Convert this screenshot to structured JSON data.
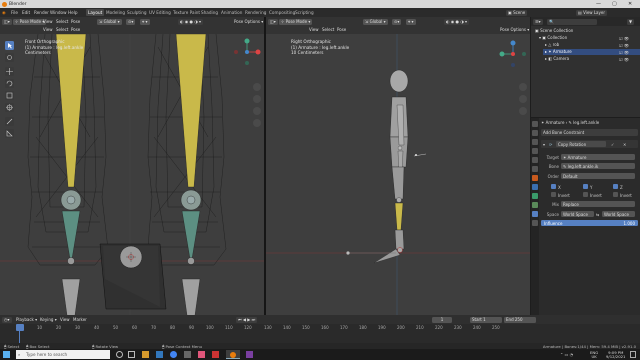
{
  "window": {
    "title": "Blender",
    "min": "—",
    "max": "▢",
    "close": "✕"
  },
  "menu": [
    "File",
    "Edit",
    "Render",
    "Window",
    "Help"
  ],
  "workspaces": [
    {
      "label": "Layout",
      "active": true
    },
    {
      "label": "Modeling"
    },
    {
      "label": "Sculpting"
    },
    {
      "label": "UV Editing"
    },
    {
      "label": "Texture Paint"
    },
    {
      "label": "Shading"
    },
    {
      "label": "Animation"
    },
    {
      "label": "Rendering"
    },
    {
      "label": "Compositing"
    },
    {
      "label": "Scripting"
    }
  ],
  "scene": {
    "label": "Scene",
    "view_layer": "View Layer"
  },
  "left_viewport": {
    "mode": "Pose Mode",
    "view": "View",
    "select": "Select",
    "pose": "Pose",
    "orientation": "Global",
    "options": "Pose Options ▾",
    "info_lines": [
      "Front Orthographic",
      "(1) Armature : leg.left.ankle",
      "Centimeters"
    ]
  },
  "right_viewport": {
    "mode": "Pose Mode",
    "view": "View",
    "select": "Select",
    "pose": "Pose",
    "orientation": "Global",
    "options": "Pose Options ▾",
    "info_lines": [
      "Right Orthographic",
      "(1) Armature : leg.left.ankle",
      "10 Centimeters"
    ]
  },
  "outliner": {
    "root": "Scene Collection",
    "items": [
      {
        "label": "Collection",
        "indent": 1
      },
      {
        "label": "rob",
        "indent": 2
      },
      {
        "label": "Armature",
        "indent": 2
      },
      {
        "label": "Camera",
        "indent": 2
      }
    ]
  },
  "properties": {
    "breadcrumb_obj": "Armature",
    "breadcrumb_bone": "leg.left.ankle",
    "add_button": "Add Bone Constraint",
    "constraint_name": "Copy Rotation",
    "target_label": "Target",
    "target_value": "Armature",
    "bone_label": "Bone",
    "bone_value": "leg.left.ankle.ik",
    "order_label": "Order",
    "order_value": "Default",
    "axis_label_x": "X",
    "axis_label_y": "Y",
    "axis_label_z": "Z",
    "invert_label": "Invert",
    "mix_label": "Mix",
    "mix_value": "Replace",
    "space_label": "Space",
    "space_owner": "World Space",
    "space_arrow": "⇆",
    "space_target": "World Space",
    "influence_label": "Influence",
    "influence_value": "1.000",
    "influence_fraction": 1.0
  },
  "timeline": {
    "menus": [
      "Playback ▾",
      "Keying ▾",
      "View",
      "Marker"
    ],
    "frame_current": "1",
    "start_label": "Start",
    "start_value": "1",
    "end_label": "End",
    "end_value": "250",
    "ticks": [
      "0",
      "10",
      "20",
      "30",
      "40",
      "50",
      "60",
      "70",
      "80",
      "90",
      "100",
      "110",
      "120",
      "130",
      "140",
      "150",
      "160",
      "170",
      "180",
      "190",
      "200",
      "210",
      "220",
      "230",
      "240",
      "250"
    ]
  },
  "statusbar": {
    "select": "Select",
    "box_select": "Box Select",
    "rotate_view": "Rotate View",
    "context_menu": "Pose Context Menu",
    "stats": "Armature | Bones:1/44 | Mem: 59.4 MiB | v2.91.0"
  },
  "taskbar": {
    "search_placeholder": "Type here to search",
    "lang": "ENG",
    "region": "UK",
    "time": "9:09 PM",
    "date": "9/12/2021"
  },
  "colors": {
    "accent": "#5680c2",
    "bone_yellow": "#c9b94a",
    "bone_teal": "#4f7e73",
    "grid_red": "#8a3a3a"
  }
}
